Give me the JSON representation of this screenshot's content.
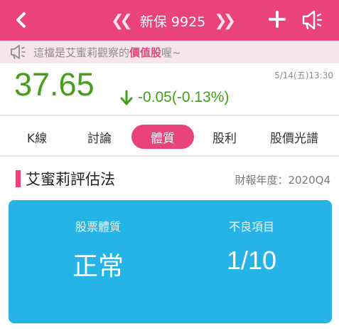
{
  "header": {
    "title": "新保 9925",
    "prev_glyph": "《",
    "next_glyph": "》"
  },
  "notice": {
    "prefix": "這檔是艾蜜莉觀察的",
    "highlight": "價值股",
    "suffix": "喔~"
  },
  "quote": {
    "price": "37.65",
    "change": "-0.05(-0.13%)",
    "datetime": "5/14(五)13:30",
    "trend": "down"
  },
  "tabs": [
    {
      "label": "K線",
      "active": false
    },
    {
      "label": "討論",
      "active": false
    },
    {
      "label": "體質",
      "active": true
    },
    {
      "label": "股利",
      "active": false
    },
    {
      "label": "股價光譜",
      "active": false
    }
  ],
  "section": {
    "title": "艾蜜莉評估法",
    "fiscal": "財報年度：2020Q4"
  },
  "card": {
    "health_label": "股票體質",
    "health_value": "正常",
    "defects_label": "不良項目",
    "defects_value": "1/10"
  },
  "colors": {
    "brand": "#e9437a",
    "price_green": "#43a01b",
    "card_blue": "#26b3e5"
  }
}
